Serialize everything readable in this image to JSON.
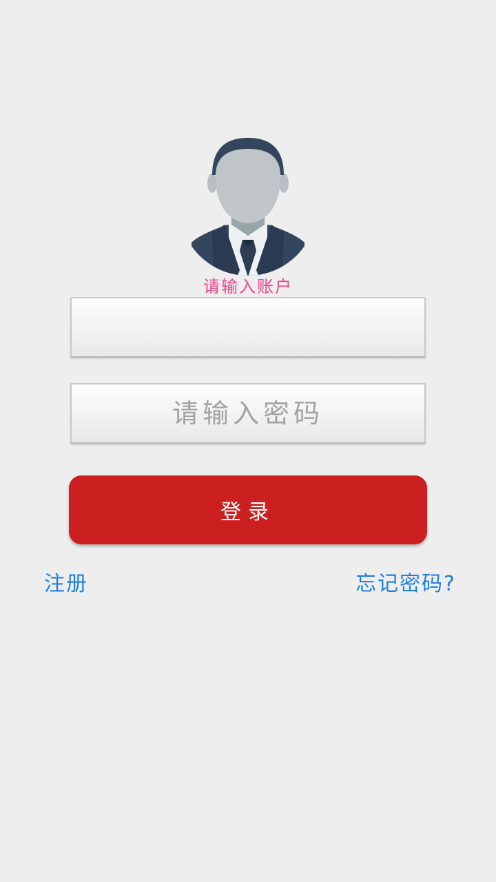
{
  "login": {
    "account_label": "请输入账户",
    "account_value": "",
    "password_placeholder": "请输入密码",
    "login_button": "登录",
    "register_link": "注册",
    "forgot_link": "忘记密码?"
  },
  "colors": {
    "background": "#eeeeee",
    "accent_red": "#cc2020",
    "label_pink": "#e8478b",
    "link_blue": "#1f7fe0"
  },
  "icons": {
    "avatar": "businessman-avatar-icon"
  }
}
